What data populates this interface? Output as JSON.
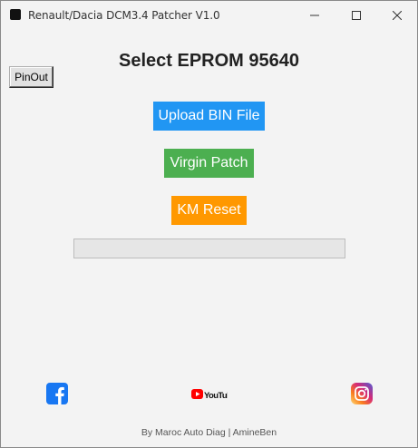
{
  "window": {
    "title": "Renault/Dacia DCM3.4 Patcher V1.0"
  },
  "pinout_label": "PinOut",
  "heading": "Select EPROM 95640",
  "buttons": {
    "upload": "Upload BIN File",
    "virgin": "Virgin Patch",
    "km": "KM Reset"
  },
  "progress": {
    "value": 0
  },
  "social": {
    "youtube_text": "YouTube",
    "icons": [
      "facebook-icon",
      "youtube-icon",
      "instagram-icon"
    ]
  },
  "footer": "By Maroc Auto Diag | AmineBen",
  "colors": {
    "upload": "#2196f3",
    "virgin": "#4caf50",
    "km": "#ff9800",
    "facebook": "#1877f2",
    "youtube": "#ff0000"
  }
}
